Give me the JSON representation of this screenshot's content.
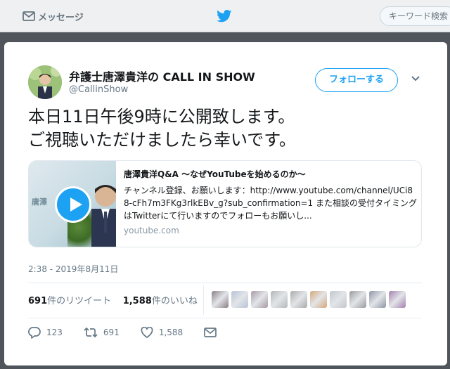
{
  "nav": {
    "messages_label": "メッセージ",
    "search_placeholder": "キーワード検索"
  },
  "tweet": {
    "display_name": "弁護士唐澤貴洋の CALL IN SHOW",
    "handle": "@CallinShow",
    "follow_label": "フォローする",
    "text_lines": [
      "本日11日午後9時に公開致します。",
      "ご視聴いただけましたら幸いです。"
    ],
    "link_card": {
      "title": "唐澤貴洋Q&A ～なぜYouTubeを始めるのか～",
      "description": "チャンネル登録、お願いします：http://www.youtube.com/channel/UCi88-cFh7m3FKg3rlkEBv_g?sub_confirmation=1 また相談の受付タイミングはTwitterにて行いますのでフォローもお願いし...",
      "domain": "youtube.com",
      "thumb_text": "唐澤"
    },
    "timestamp": "2:38 - 2019年8月11日",
    "stats": {
      "retweet_count": "691",
      "retweet_label": "件のリツイート",
      "like_count": "1,588",
      "like_label": "件のいいね"
    },
    "actions": {
      "reply_count": "123",
      "retweet_count": "691",
      "like_count": "1,588"
    }
  },
  "colors": {
    "accent": "#1da1f2",
    "text": "#14171a",
    "muted": "#657786"
  },
  "liker_colors": [
    "#8a7f87",
    "#b7c3d8",
    "#a79aa6",
    "#b2b7b9",
    "#a9aaa9",
    "#d7a77c",
    "#c2c6cc",
    "#9a9aa0",
    "#8f95a7",
    "#a57fb0"
  ]
}
